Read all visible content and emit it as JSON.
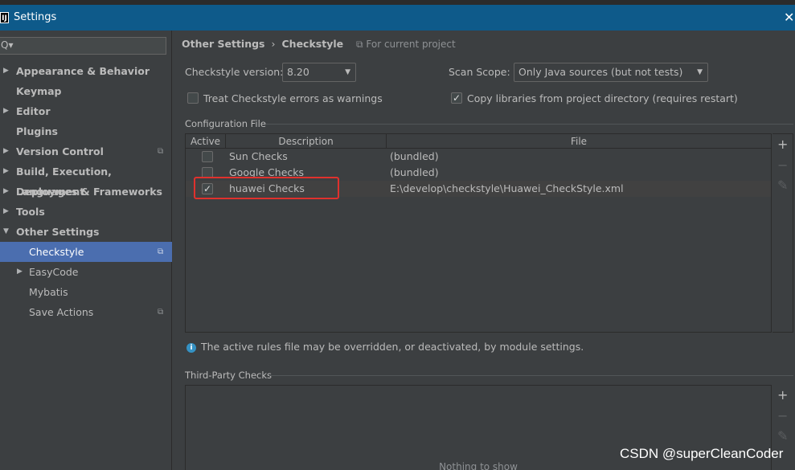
{
  "window": {
    "app_icon": "IJ",
    "title": "Settings",
    "close": "✕"
  },
  "search": {
    "icon": "Q▾",
    "value": ""
  },
  "sidebar": {
    "items": [
      {
        "label": "Appearance & Behavior",
        "arrow": "▶"
      },
      {
        "label": "Keymap",
        "arrow": ""
      },
      {
        "label": "Editor",
        "arrow": "▶"
      },
      {
        "label": "Plugins",
        "arrow": ""
      },
      {
        "label": "Version Control",
        "arrow": "▶",
        "project": "⧉"
      },
      {
        "label": "Build, Execution, Deployment",
        "arrow": "▶"
      },
      {
        "label": "Languages & Frameworks",
        "arrow": "▶"
      },
      {
        "label": "Tools",
        "arrow": "▶"
      },
      {
        "label": "Other Settings",
        "arrow": "▼"
      },
      {
        "label": "Checkstyle",
        "arrow": "",
        "project": "⧉"
      },
      {
        "label": "EasyCode",
        "arrow": "▶"
      },
      {
        "label": "Mybatis",
        "arrow": ""
      },
      {
        "label": "Save Actions",
        "arrow": "",
        "project": "⧉"
      }
    ]
  },
  "breadcrumb": {
    "parent": "Other Settings",
    "sep": "›",
    "current": "Checkstyle",
    "scope": "⧉ For current project"
  },
  "settings": {
    "version_label": "Checkstyle version:",
    "version_value": "8.20",
    "scan_label": "Scan Scope:",
    "scan_value": "Only Java sources (but not tests)",
    "treat_warnings_label": "Treat Checkstyle errors as warnings",
    "treat_warnings_checked": false,
    "copy_libs_label": "Copy libraries from project directory (requires restart)",
    "copy_libs_checked": true
  },
  "config": {
    "section_title": "Configuration File",
    "headers": {
      "active": "Active",
      "description": "Description",
      "file": "File"
    },
    "rows": [
      {
        "active": false,
        "check": "",
        "description": "Sun Checks",
        "file": "(bundled)"
      },
      {
        "active": false,
        "check": "",
        "description": "Google Checks",
        "file": "(bundled)"
      },
      {
        "active": true,
        "check": "✓",
        "description": "huawei Checks",
        "file": "E:\\develop\\checkstyle\\Huawei_CheckStyle.xml"
      }
    ],
    "tools": {
      "add": "+",
      "remove": "−",
      "edit": "✎"
    },
    "info_icon": "i",
    "info_text": "The active rules file may be overridden, or deactivated, by module settings."
  },
  "third_party": {
    "section_title": "Third-Party Checks",
    "empty_text": "Nothing to show",
    "tools": {
      "add": "+",
      "remove": "−",
      "edit": "✎"
    }
  },
  "watermark": "CSDN @superCleanCoder",
  "colors": {
    "title_bar": "#0e5a8a",
    "selection": "#4b6eaf",
    "highlight_box": "#e0312d",
    "background": "#3c3f41"
  }
}
